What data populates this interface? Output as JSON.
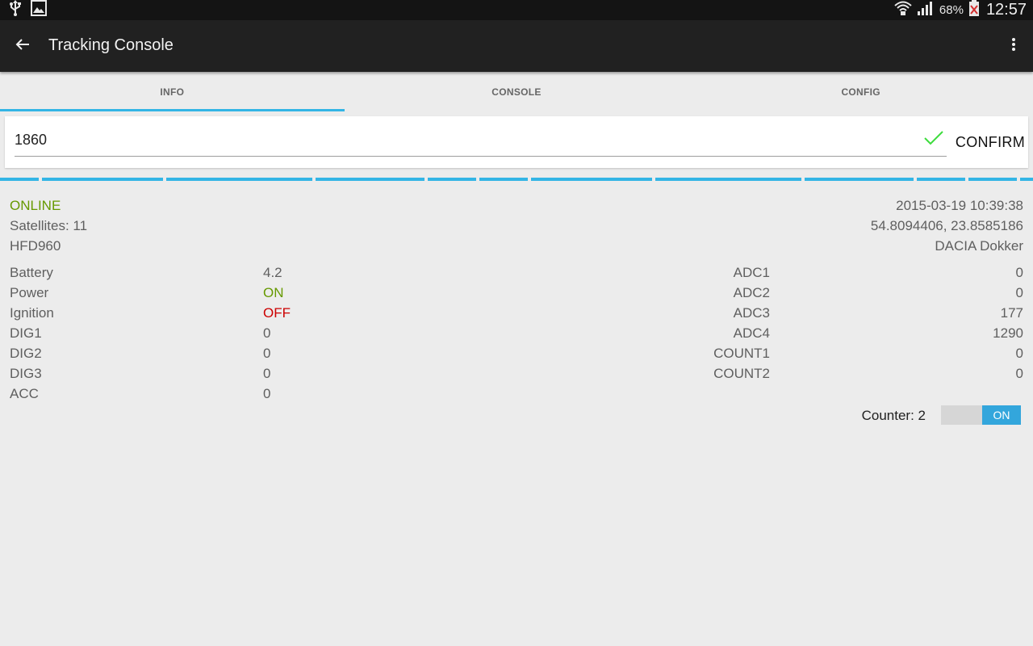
{
  "status_bar": {
    "left_icons": [
      "usb-icon",
      "image-icon"
    ],
    "right_icons": [
      "wifi-icon",
      "signal-icon",
      "battery-icon"
    ],
    "battery_percent": "68%",
    "time": "12:57"
  },
  "action_bar": {
    "title": "Tracking Console",
    "back_icon": "arrow-back-icon",
    "overflow_icon": "more-vert-icon"
  },
  "tabs": [
    {
      "label": "INFO",
      "active": true
    },
    {
      "label": "CONSOLE",
      "active": false
    },
    {
      "label": "CONFIG",
      "active": false
    }
  ],
  "device_input": {
    "value": "1860",
    "confirm_label": "CONFIRM",
    "check_color": "#3ddc3d"
  },
  "status": {
    "online": "ONLINE",
    "satellites": "Satellites: 11",
    "plate": "HFD960",
    "datetime": "2015-03-19 10:39:38",
    "coordinates": "54.8094406, 23.8585186",
    "vehicle": "DACIA Dokker"
  },
  "left_fields": [
    {
      "label": "Battery",
      "value": "4.2",
      "tone": ""
    },
    {
      "label": "Power",
      "value": "ON",
      "tone": "green"
    },
    {
      "label": "Ignition",
      "value": "OFF",
      "tone": "red"
    },
    {
      "label": "DIG1",
      "value": "0",
      "tone": ""
    },
    {
      "label": "DIG2",
      "value": "0",
      "tone": ""
    },
    {
      "label": "DIG3",
      "value": "0",
      "tone": ""
    },
    {
      "label": "ACC",
      "value": "0",
      "tone": ""
    }
  ],
  "right_fields": [
    {
      "label": "ADC1",
      "value": "0"
    },
    {
      "label": "ADC2",
      "value": "0"
    },
    {
      "label": "ADC3",
      "value": "177"
    },
    {
      "label": "ADC4",
      "value": "1290"
    },
    {
      "label": "COUNT1",
      "value": "0"
    },
    {
      "label": "COUNT2",
      "value": "0"
    }
  ],
  "counter": {
    "label": "Counter: 2",
    "toggle_label": "ON",
    "toggle_on": true
  },
  "colors": {
    "accent": "#33b5e5",
    "online": "#669900",
    "off": "#cc0000",
    "toolbar": "#212121"
  }
}
